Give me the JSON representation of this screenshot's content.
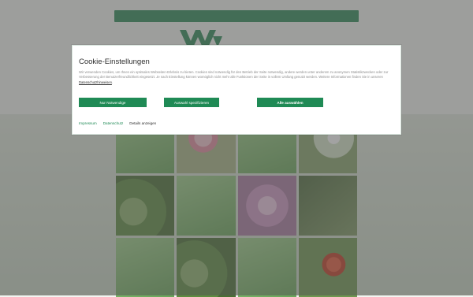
{
  "site": {
    "logo_text": "",
    "tiles": [
      {
        "label": ""
      },
      {
        "label": ""
      },
      {
        "label": ""
      },
      {
        "label": ""
      },
      {
        "label": ""
      },
      {
        "label": ""
      },
      {
        "label": ""
      },
      {
        "label": ""
      },
      {
        "label": ""
      },
      {
        "label": ""
      },
      {
        "label": ""
      },
      {
        "label": ""
      }
    ]
  },
  "cookie_dialog": {
    "title": "Cookie-Einstellungen",
    "text_before_link": "Wir verwenden Cookies, um Ihnen ein optimales Webseiten-Erlebnis zu bieten. Cookies sind notwendig für den Betrieb der Seite notwendig, andere werden unter anderem zu anonymen Statistikzwecken oder zur Verbesserung der Benutzerfreundlichkeit eingesetzt. Je nach Einstellung können womöglich nicht mehr alle Funktionen der Seite in vollem Umfang genutzt werden. Weitere Informationen finden Sie in unseren",
    "policy_link": "Datenschutzhinweisen",
    "text_after_link": ".",
    "buttons": {
      "necessary": "Nur Notwendige",
      "select": "Auswahl spezifizieren",
      "all": "Alle auswählen"
    },
    "links": {
      "imprint": "Impressum",
      "privacy": "Datenschutz",
      "details": "Details anzeigen"
    }
  },
  "colors": {
    "accent": "#1f8a55",
    "top_bar": "#2e8b57",
    "overlay": "#555555"
  },
  "icons": {
    "logo": "wm-logo-icon"
  }
}
